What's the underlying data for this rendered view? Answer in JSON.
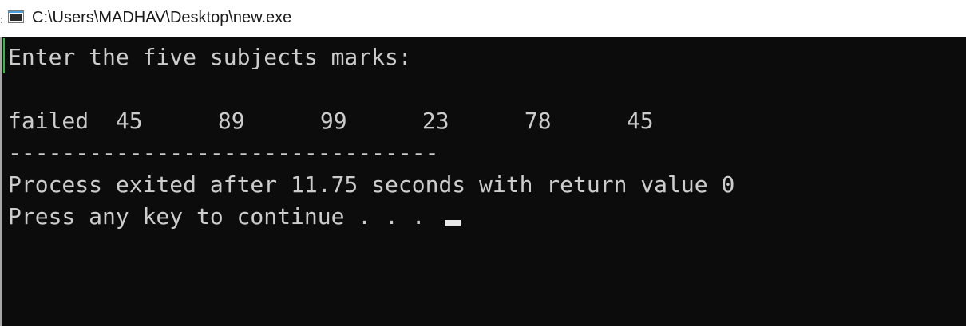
{
  "window": {
    "title": "C:\\Users\\MADHAV\\Desktop\\new.exe",
    "icon": "console-app-icon"
  },
  "console": {
    "prompt_line": "Enter the five subjects marks:",
    "marks": [
      "45",
      "89",
      "99",
      "23",
      "78",
      "45"
    ],
    "result_line": "failed",
    "separator_line": "--------------------------------",
    "process_line": "Process exited after 11.75 seconds with return value 0",
    "continue_line": "Press any key to continue . . . ",
    "colors": {
      "background": "#0c0c0c",
      "text": "#cccccc"
    }
  }
}
